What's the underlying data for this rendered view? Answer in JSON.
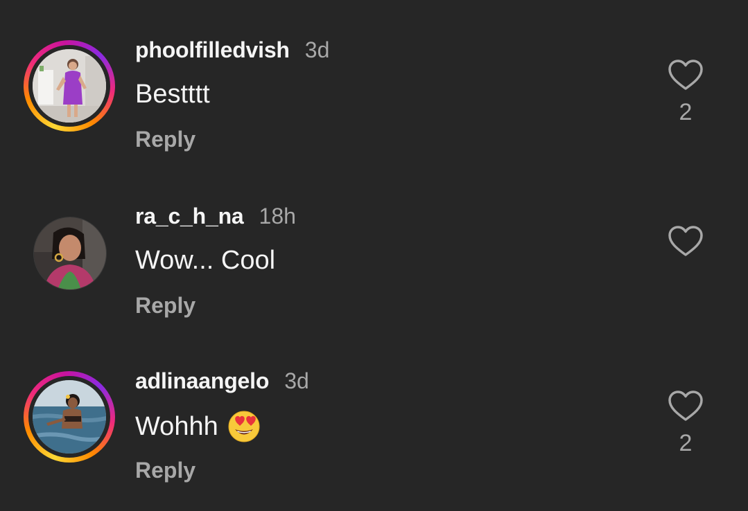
{
  "comments": [
    {
      "username": "phoolfilledvish",
      "time": "3d",
      "text": "Bestttt",
      "reply_label": "Reply",
      "like_count": "2",
      "has_story": true,
      "avatar": "avatar-woman-purple-dress"
    },
    {
      "username": "ra_c_h_na",
      "time": "18h",
      "text": "Wow... Cool",
      "reply_label": "Reply",
      "like_count": "",
      "has_story": false,
      "avatar": "avatar-woman-earrings"
    },
    {
      "username": "adlinaangelo",
      "time": "3d",
      "text": "Wohhh",
      "emoji": "heart-eyes-emoji",
      "reply_label": "Reply",
      "like_count": "2",
      "has_story": true,
      "avatar": "avatar-woman-pool"
    }
  ],
  "colors": {
    "background": "#262626",
    "primary_text": "#f5f5f5",
    "secondary_text": "#a8a8a8",
    "story_ring": [
      "#fdd835",
      "#ff8a00",
      "#ee2a7b",
      "#c9139e"
    ]
  },
  "icons": {
    "like": "heart-outline-icon"
  }
}
